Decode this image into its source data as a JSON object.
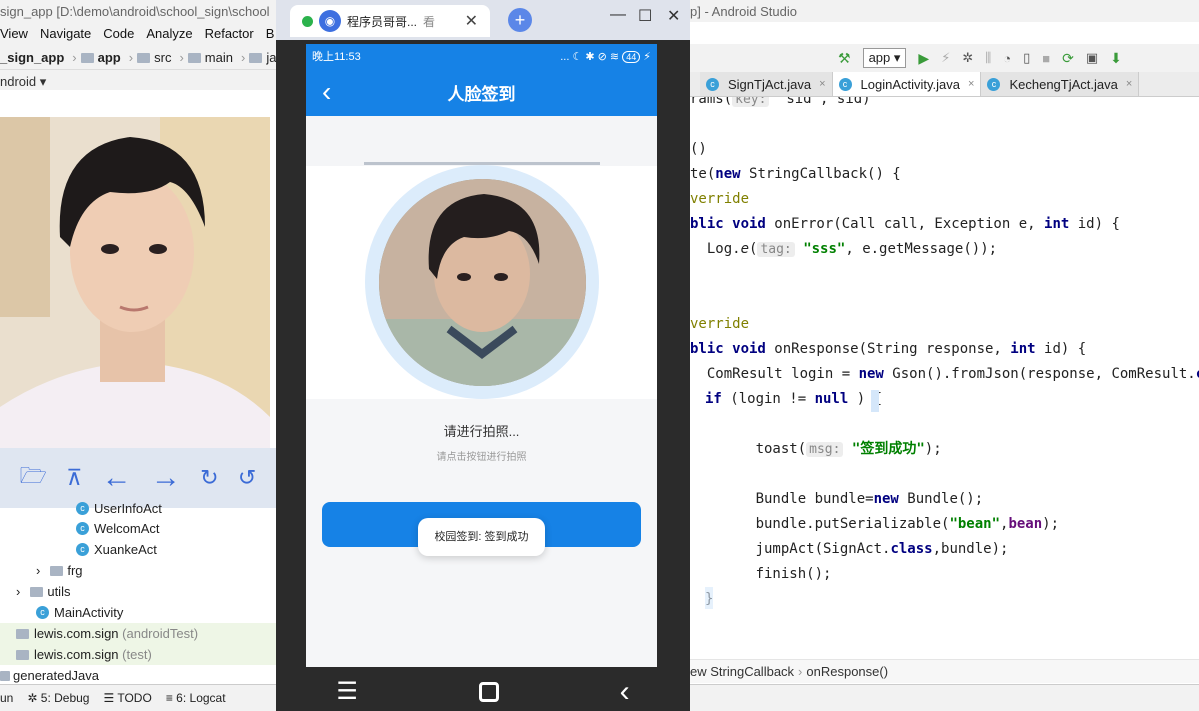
{
  "left_ide": {
    "title": "sign_app [D:\\demo\\android\\school_sign\\school",
    "menu": [
      "View",
      "Navigate",
      "Code",
      "Analyze",
      "Refactor",
      "B"
    ],
    "breadcrumb": [
      "_sign_app",
      "app",
      "src",
      "main",
      "java"
    ],
    "android_label": "ndroid",
    "tree": [
      {
        "label": "UserInfoAct",
        "type": "class"
      },
      {
        "label": "WelcomAct",
        "type": "class"
      },
      {
        "label": "XuankeAct",
        "type": "class"
      },
      {
        "label": "frg",
        "type": "folder"
      },
      {
        "label": "utils",
        "type": "folder"
      },
      {
        "label": "MainActivity",
        "type": "class"
      },
      {
        "label": "lewis.com.sign",
        "suffix": "(androidTest)",
        "type": "package"
      },
      {
        "label": "lewis.com.sign",
        "suffix": "(test)",
        "type": "package"
      },
      {
        "label": "generatedJava",
        "type": "package"
      }
    ],
    "bottom_tabs": [
      "un",
      "5: Debug",
      "TODO",
      "6: Logcat"
    ]
  },
  "browser": {
    "tab_title": "程序员哥哥...",
    "tab_suffix": "看",
    "new_tab": "+",
    "close": "✕",
    "minimize": "—",
    "maximize": "☐",
    "window_close": "✕"
  },
  "phone": {
    "status_time": "晚上11:53",
    "status_icons": "... ☾ ✱ ⊘ ≋ ",
    "battery": "44",
    "title": "人脸签到",
    "prompt": "请进行拍照...",
    "prompt_sub": "请点击按钮进行拍照",
    "toast": "校园签到: 签到成功"
  },
  "right_ide": {
    "title": "p] - Android Studio",
    "run_config": "app",
    "tabs": [
      {
        "label": "SignTjAct.java"
      },
      {
        "label": "LoginActivity.java"
      },
      {
        "label": "KechengTjAct.java"
      }
    ],
    "code": {
      "l1_a": "rams(",
      "l1_hint": "key:",
      "l1_b": " \"sid\", sid)",
      "l2": "()",
      "l3_a": "te(",
      "l3_kw": "new",
      "l3_b": " StringCallback() {",
      "l4": "verride",
      "l5_kw1": "blic void",
      "l5_b": " onError(Call call, Exception e, ",
      "l5_kw2": "int",
      "l5_c": " id) {",
      "l6_a": "  Log.",
      "l6_e": "e",
      "l6_b": "(",
      "l6_hint": "tag:",
      "l6_str": " \"sss\"",
      "l6_c": ", e.getMessage());",
      "l7": "verride",
      "l8_kw1": "blic void",
      "l8_b": " onResponse(String response, ",
      "l8_kw2": "int",
      "l8_c": " id) {",
      "l9_a": "  ComResult login = ",
      "l9_kw": "new",
      "l9_b": " Gson().fromJson(response, ComResult.",
      "l9_kw2": "cla",
      "l10_kw": "if",
      "l10_b": " (login != ",
      "l10_kw2": "null",
      "l10_c": " ) {",
      "l11_a": "      toast(",
      "l11_hint": "msg:",
      "l11_str": " \"签到成功\"",
      "l11_b": ");",
      "l12_a": "      Bundle bundle=",
      "l12_kw": "new",
      "l12_b": " Bundle();",
      "l13_a": "      bundle.putSerializable(",
      "l13_str": "\"bean\"",
      "l13_b": ",",
      "l13_fld": "bean",
      "l13_c": ");",
      "l14_a": "      jumpAct(SignAct.",
      "l14_kw": "class",
      "l14_b": ",bundle);",
      "l15": "      finish();",
      "l16": "}"
    },
    "breadcrumb": [
      "ew StringCallback",
      "onResponse()"
    ]
  }
}
